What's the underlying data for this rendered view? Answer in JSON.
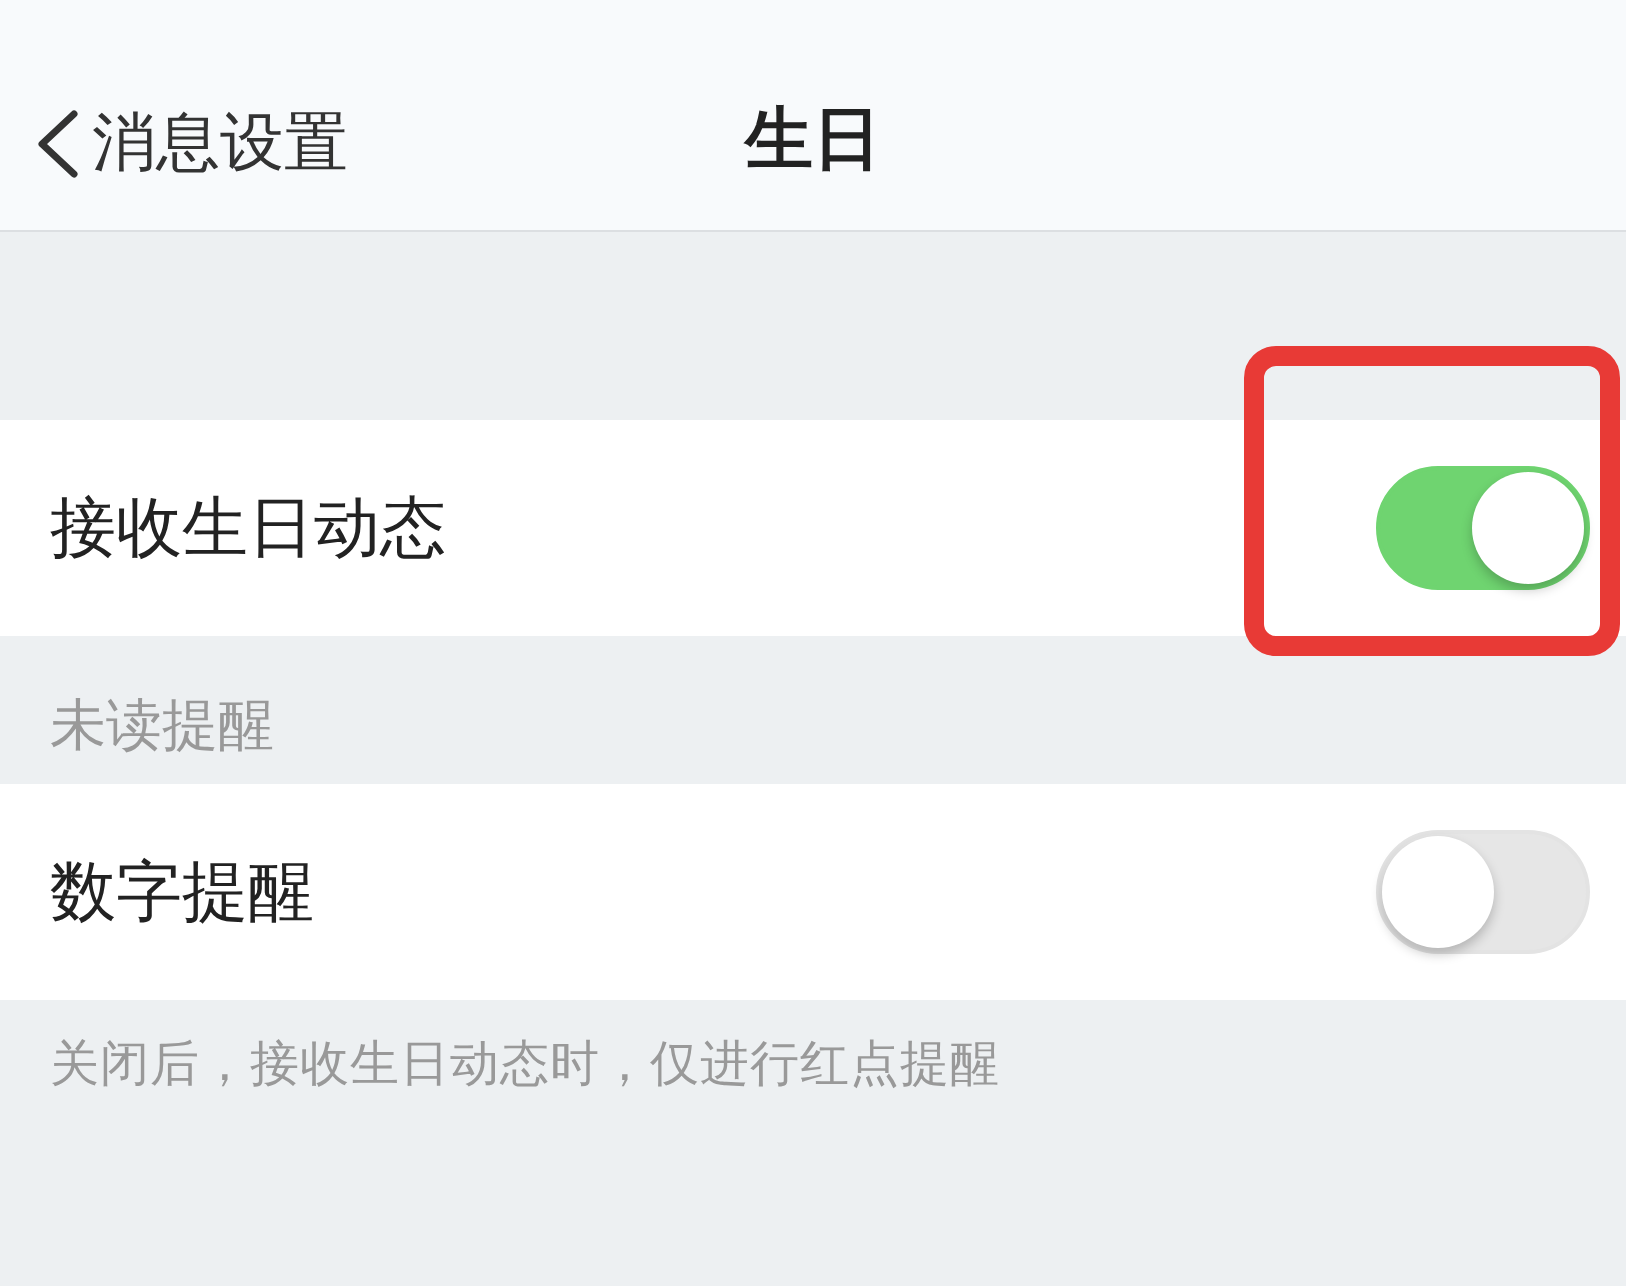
{
  "nav_bar": {
    "back_label": "消息设置",
    "title": "生日"
  },
  "sections": [
    {
      "settings": [
        {
          "label": "接收生日动态",
          "on": true,
          "highlighted": true
        }
      ]
    },
    {
      "header": "未读提醒",
      "settings": [
        {
          "label": "数字提醒",
          "on": false,
          "highlighted": false
        }
      ],
      "footer": "关闭后，接收生日动态时，仅进行红点提醒"
    }
  ]
}
